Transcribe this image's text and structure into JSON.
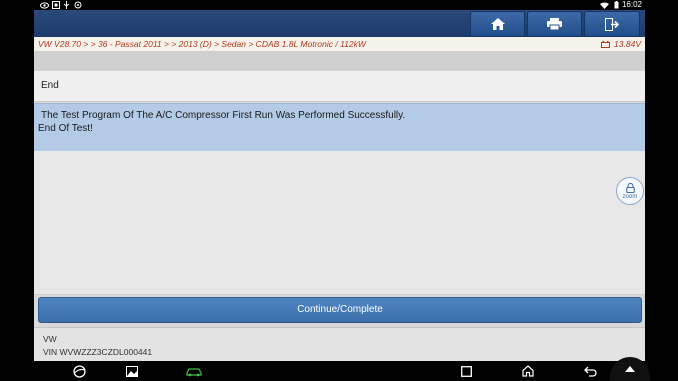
{
  "app": {
    "breadcrumb": "VW V28.70 >  > 36 - Passat 2011 > > 2013 (D) > Sedan > CDAB 1.8L Motronic / 112kW",
    "voltage": "13.84V",
    "title": "End",
    "message_line1": "The Test Program Of The A/C Compressor First Run Was Performed Successfully.",
    "message_line2": "End Of Test!",
    "continue_label": "Continue/Complete",
    "footer_make": "VW",
    "footer_vin": "VIN WVWZZZ3CZDL000441",
    "zoom_label": "zoom"
  },
  "statusbar": {
    "time": "16:02"
  },
  "icons": {
    "header": [
      "home-icon",
      "print-icon",
      "exit-icon"
    ],
    "navbar": [
      "browser-icon",
      "gallery-icon",
      "car-icon",
      "recents-icon",
      "home-icon",
      "back-icon",
      "collapse-icon"
    ]
  },
  "colors": {
    "header": "#1c3a6b",
    "breadcrumb_text": "#b23a23",
    "message_bg": "#b3cbe6",
    "button": "#3a6fab"
  }
}
